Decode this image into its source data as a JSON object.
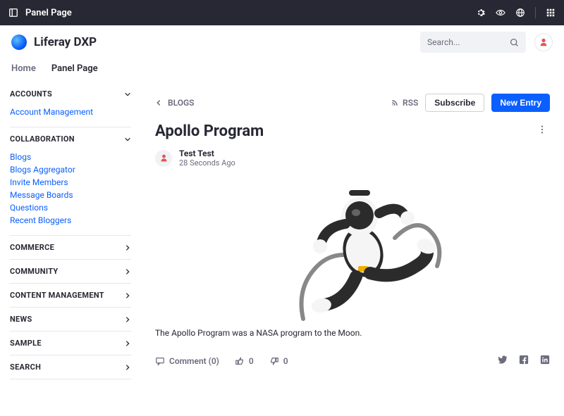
{
  "topbar": {
    "title": "Panel Page"
  },
  "header": {
    "brand": "Liferay DXP",
    "search_placeholder": "Search..."
  },
  "nav": {
    "home": "Home",
    "panel": "Panel Page"
  },
  "sidebar": {
    "groups": [
      {
        "title": "ACCOUNTS",
        "open": true,
        "links": [
          "Account Management"
        ]
      },
      {
        "title": "COLLABORATION",
        "open": true,
        "links": [
          "Blogs",
          "Blogs Aggregator",
          "Invite Members",
          "Message Boards",
          "Questions",
          "Recent Bloggers"
        ]
      },
      {
        "title": "COMMERCE",
        "open": false
      },
      {
        "title": "COMMUNITY",
        "open": false
      },
      {
        "title": "CONTENT MANAGEMENT",
        "open": false
      },
      {
        "title": "NEWS",
        "open": false
      },
      {
        "title": "SAMPLE",
        "open": false
      },
      {
        "title": "SEARCH",
        "open": false
      }
    ]
  },
  "blog": {
    "breadcrumb": "BLOGS",
    "rss_label": "RSS",
    "subscribe_label": "Subscribe",
    "new_entry_label": "New Entry",
    "title": "Apollo Program",
    "author": "Test Test",
    "time": "28 Seconds Ago",
    "description": "The Apollo Program was a NASA program to the Moon.",
    "comment_label": "Comment (0)",
    "likes": "0",
    "dislikes": "0"
  }
}
